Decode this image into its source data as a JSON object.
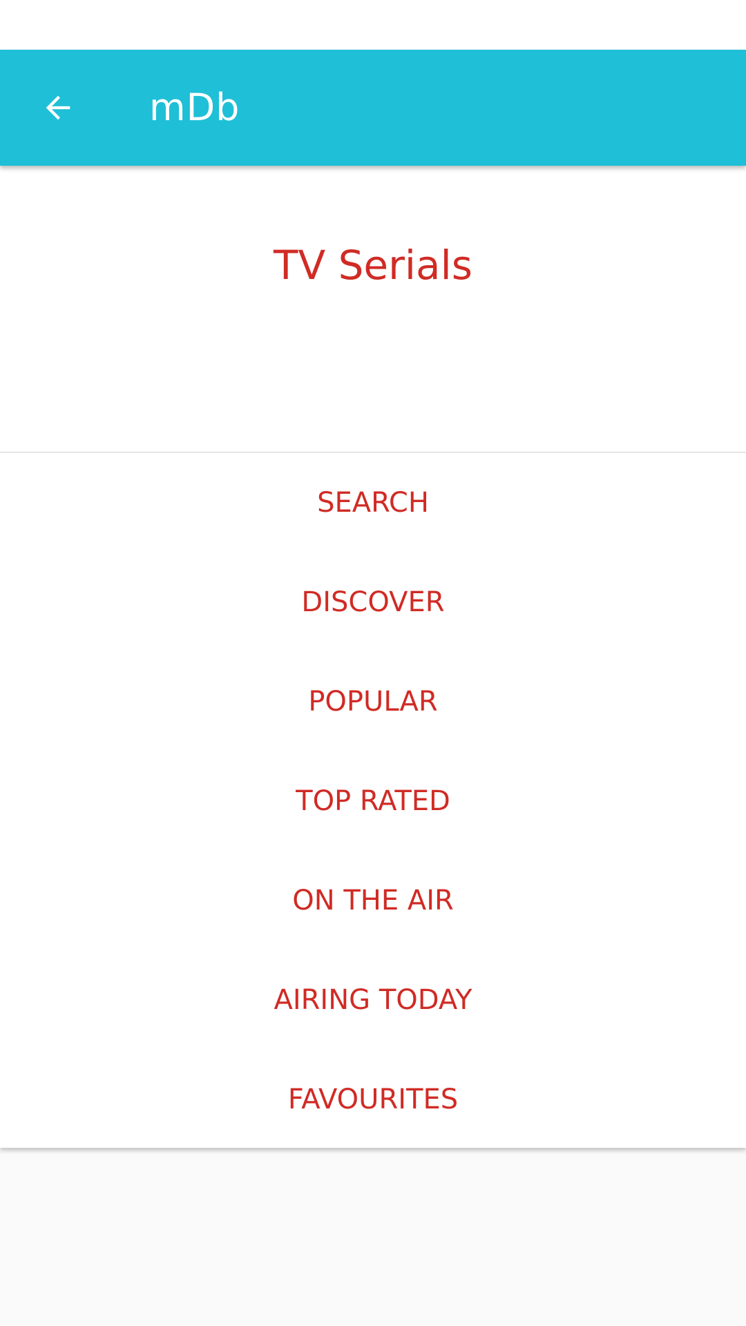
{
  "app_bar": {
    "title": "mDb",
    "back_icon": "arrow-back-icon",
    "background_color": "#1fbfd7"
  },
  "content": {
    "title": "TV Serials",
    "accent_color": "#d02b25",
    "menu": [
      {
        "label": "SEARCH"
      },
      {
        "label": "DISCOVER"
      },
      {
        "label": "POPULAR"
      },
      {
        "label": "TOP RATED"
      },
      {
        "label": "ON THE AIR"
      },
      {
        "label": "AIRING TODAY"
      },
      {
        "label": "FAVOURITES"
      }
    ]
  }
}
